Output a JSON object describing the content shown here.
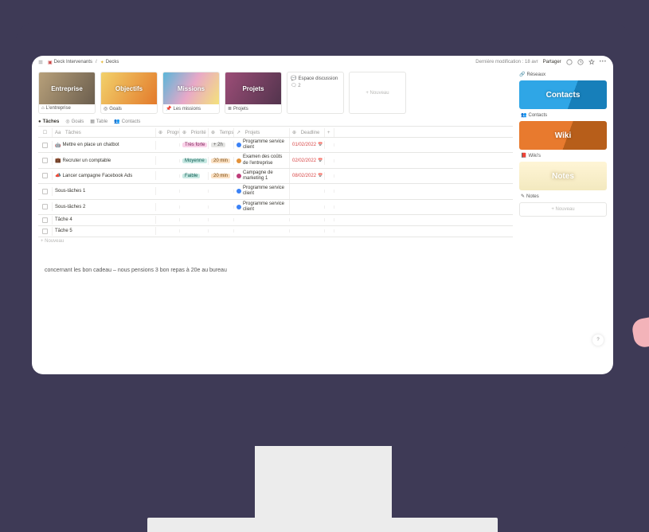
{
  "header": {
    "breadcrumbs": [
      {
        "icon": "stack-red",
        "label": "Deck Intervenants"
      },
      {
        "icon": "sparkle-yellow",
        "label": "Decks"
      }
    ],
    "last_modified": "Dernière modification : 18 avr",
    "share": "Partager"
  },
  "gallery": [
    {
      "overlay": "Entreprise",
      "sub": "L'entreprise",
      "style": "entreprise",
      "sub_icon": "house"
    },
    {
      "overlay": "Objectifs",
      "sub": "Goals",
      "style": "objectifs",
      "sub_icon": "target"
    },
    {
      "overlay": "Missions",
      "sub": "Les missions",
      "style": "missions",
      "sub_icon": "pin"
    },
    {
      "overlay": "Projets",
      "sub": "Projets",
      "style": "projets",
      "sub_icon": "list"
    }
  ],
  "gallery_extra": {
    "discussion": {
      "label": "Espace discussion",
      "sub": "🗨 2"
    },
    "new_card": "+ Nouveau"
  },
  "views": [
    {
      "label": "Tâches",
      "active": true,
      "icon": "check"
    },
    {
      "label": "Goals",
      "active": false,
      "icon": "target"
    },
    {
      "label": "Table",
      "active": false,
      "icon": "table"
    },
    {
      "label": "Contacts",
      "active": false,
      "icon": "people"
    }
  ],
  "columns": {
    "check": "",
    "task": "Tâches",
    "progress": "Progrès",
    "priority": "Priorité",
    "time": "Temps",
    "projects": "Projets",
    "deadline": "Deadline",
    "add": "+"
  },
  "rows": [
    {
      "task_icon": "🤖",
      "task": "Mettre en place un chatbot",
      "priority": {
        "label": "Très forte",
        "tone": "pink"
      },
      "time": {
        "label": "+ 2h",
        "tone": "grey"
      },
      "projects": [
        {
          "dot": "blue",
          "label": "Programme service client"
        }
      ],
      "deadline": {
        "text": "01/02/2022",
        "overdue": true
      }
    },
    {
      "task_icon": "💼",
      "task": "Recruter un comptable",
      "priority": {
        "label": "Moyenne",
        "tone": "teal"
      },
      "time": {
        "label": "20 min",
        "tone": "orange"
      },
      "projects": [
        {
          "dot": "flame",
          "label": "Examen des coûts de l'entreprise"
        }
      ],
      "deadline": {
        "text": "02/02/2022",
        "overdue": true
      }
    },
    {
      "task_icon": "📣",
      "task": "Lancer campagne Facebook Ads",
      "priority": {
        "label": "Faible",
        "tone": "teal"
      },
      "time": {
        "label": "20 min",
        "tone": "orange"
      },
      "projects": [
        {
          "dot": "pink",
          "label": "Campagne de marketing 1"
        }
      ],
      "deadline": {
        "text": "08/02/2022",
        "overdue": true
      }
    },
    {
      "task": "Sous-tâches 1",
      "projects": [
        {
          "dot": "blue",
          "label": "Programme service client"
        }
      ]
    },
    {
      "task": "Sous-tâches 2",
      "projects": [
        {
          "dot": "blue",
          "label": "Programme service client"
        }
      ]
    },
    {
      "task": "Tâche 4"
    },
    {
      "task": "Tâche 5"
    }
  ],
  "new_row": "+ Nouveau",
  "note": "concernant les bon cadeau – nous pensions 3 bon repas à 20e au bureau",
  "sidebar": {
    "top_label": "Réseaux",
    "cards": [
      {
        "title": "Contacts",
        "style": "contacts",
        "sub": "Contacts",
        "sub_icon": "people"
      },
      {
        "title": "Wiki",
        "style": "wiki",
        "sub": "Wiki's",
        "sub_icon": "book"
      },
      {
        "title": "Notes",
        "style": "notes",
        "sub": "Notes",
        "sub_icon": "pencil"
      }
    ],
    "new_card": "+ Nouveau"
  },
  "help_bubble": "?"
}
